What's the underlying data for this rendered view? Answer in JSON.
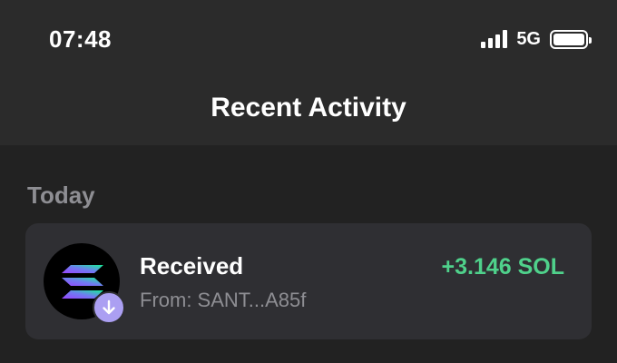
{
  "status_bar": {
    "time": "07:48",
    "network": "5G",
    "signal_icon": "signal-bars-icon",
    "battery_icon": "battery-icon"
  },
  "header": {
    "title": "Recent Activity"
  },
  "section": {
    "label": "Today"
  },
  "transactions": [
    {
      "title": "Received",
      "subtitle": "From: SANT...A85f",
      "amount": "+3.146 SOL",
      "amount_color": "#4fd18b",
      "token_icon": "solana-logo-icon",
      "badge_icon": "arrow-down-icon",
      "badge_color": "#ab9ff2"
    }
  ]
}
